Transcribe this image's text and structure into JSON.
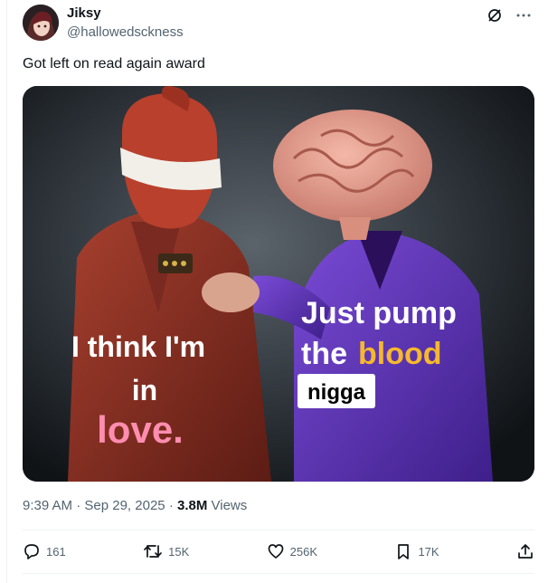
{
  "author": {
    "name": "Jiksy",
    "handle": "@hallowedsckness"
  },
  "tweet": {
    "text": "Got left on read again award"
  },
  "meme": {
    "left_line1": "I think I'm",
    "left_line2": "in",
    "left_line3": "love.",
    "right_line1": "Just pump",
    "right_word_the": "the",
    "right_word_blood": "blood",
    "right_boxed": "nigga"
  },
  "meta": {
    "time": "9:39 AM",
    "date": "Sep 29, 2025",
    "views_count": "3.8M",
    "views_label": "Views"
  },
  "actions": {
    "replies": "161",
    "reposts": "15K",
    "likes": "256K",
    "bookmarks": "17K"
  },
  "colors": {
    "accent_text": "#0f1419",
    "muted": "#536471",
    "meme_love": "#ff8db0",
    "meme_blood": "#f5b82e",
    "suit_purple": "#6a3fc4"
  },
  "icons": [
    "grok-icon",
    "more-icon",
    "reply-icon",
    "repost-icon",
    "like-icon",
    "bookmark-icon",
    "share-icon"
  ]
}
